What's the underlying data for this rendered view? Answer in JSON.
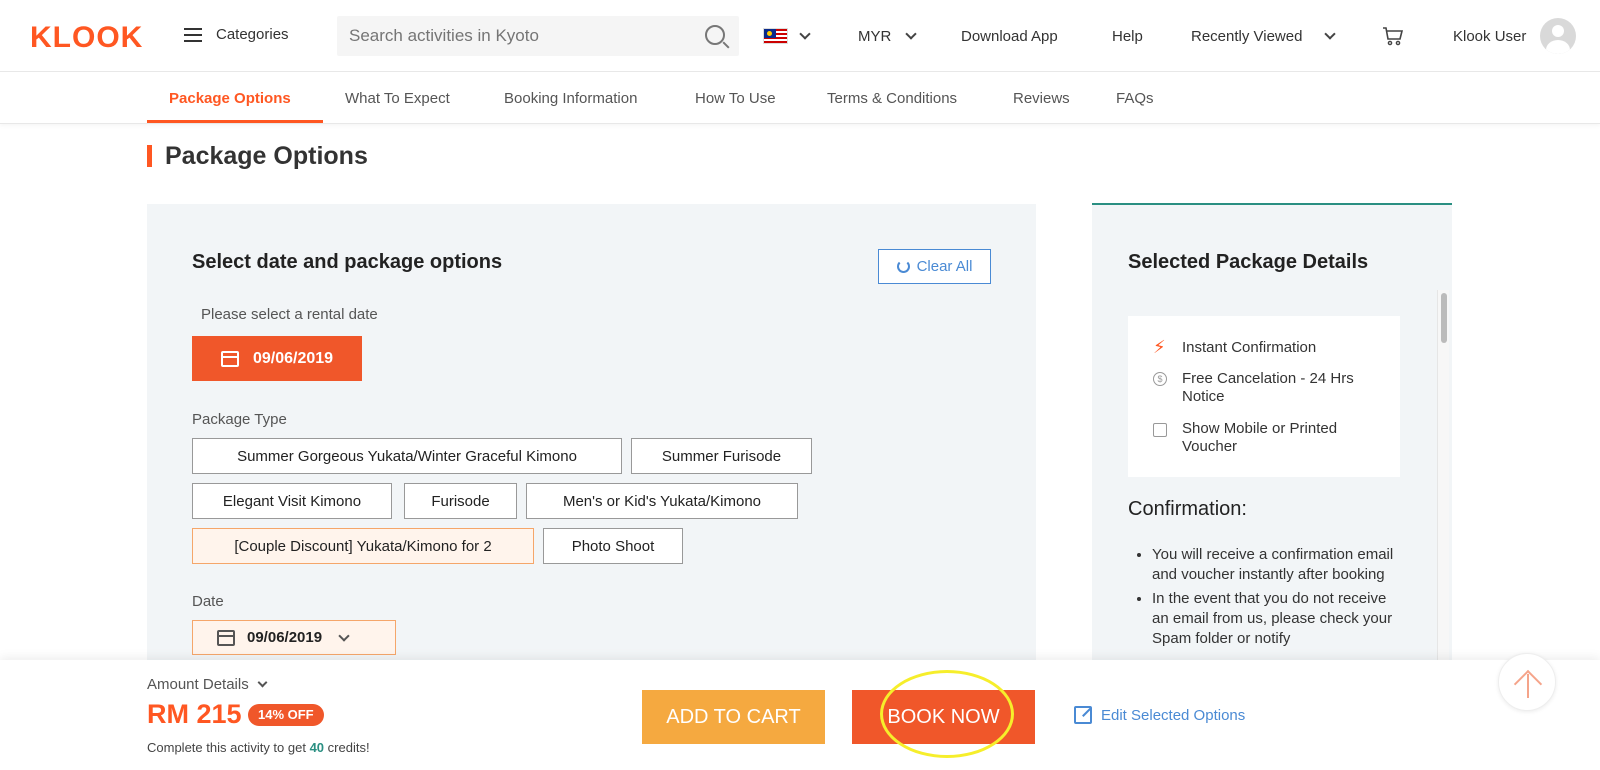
{
  "header": {
    "logo": "KLOOK",
    "categories_label": "Categories",
    "search_placeholder": "Search activities in Kyoto",
    "currency": "MYR",
    "download_app": "Download App",
    "help": "Help",
    "recently_viewed": "Recently Viewed",
    "user_name": "Klook User"
  },
  "tabs": [
    {
      "label": "Package Options",
      "active": true
    },
    {
      "label": "What To Expect"
    },
    {
      "label": "Booking Information"
    },
    {
      "label": "How To Use"
    },
    {
      "label": "Terms & Conditions"
    },
    {
      "label": "Reviews"
    },
    {
      "label": "FAQs"
    }
  ],
  "section_title": "Package Options",
  "select_panel": {
    "title": "Select date and package options",
    "clear_all": "Clear All",
    "rental_date_label": "Please select a rental date",
    "rental_date_value": "09/06/2019",
    "package_type_label": "Package Type",
    "packages": [
      {
        "label": "Summer Gorgeous Yukata/Winter Graceful Kimono"
      },
      {
        "label": "Summer Furisode"
      },
      {
        "label": "Elegant Visit Kimono"
      },
      {
        "label": "Furisode"
      },
      {
        "label": "Men's or Kid's Yukata/Kimono"
      },
      {
        "label": "[Couple Discount] Yukata/Kimono for 2",
        "selected": true
      },
      {
        "label": "Photo Shoot"
      }
    ],
    "date_label": "Date",
    "date_value": "09/06/2019"
  },
  "details_panel": {
    "title": "Selected Package Details",
    "features": [
      {
        "icon": "lightning-icon",
        "text": "Instant Confirmation"
      },
      {
        "icon": "dollar-coin-icon",
        "text": "Free Cancelation - 24 Hrs Notice"
      },
      {
        "icon": "printer-icon",
        "text": "Show Mobile or Printed Voucher"
      }
    ],
    "confirmation_title": "Confirmation:",
    "confirmation_items": [
      "You will receive a confirmation email and voucher instantly after booking",
      "In the event that you do not receive an email from us, please check your Spam folder or notify"
    ]
  },
  "bottom_bar": {
    "amount_details": "Amount Details",
    "price": "RM 215",
    "discount": "14% OFF",
    "credits_prefix": "Complete this activity to get ",
    "credits_value": "40",
    "credits_suffix": " credits!",
    "add_to_cart": "ADD TO CART",
    "book_now": "BOOK NOW",
    "edit_options": "Edit Selected Options"
  },
  "colors": {
    "brand": "#ff5722",
    "accent_orange": "#f0572a",
    "cart_orange": "#f5a940",
    "link_blue": "#4a8ad4",
    "teal": "#2a8f82",
    "highlight": "#f6ee2b"
  }
}
